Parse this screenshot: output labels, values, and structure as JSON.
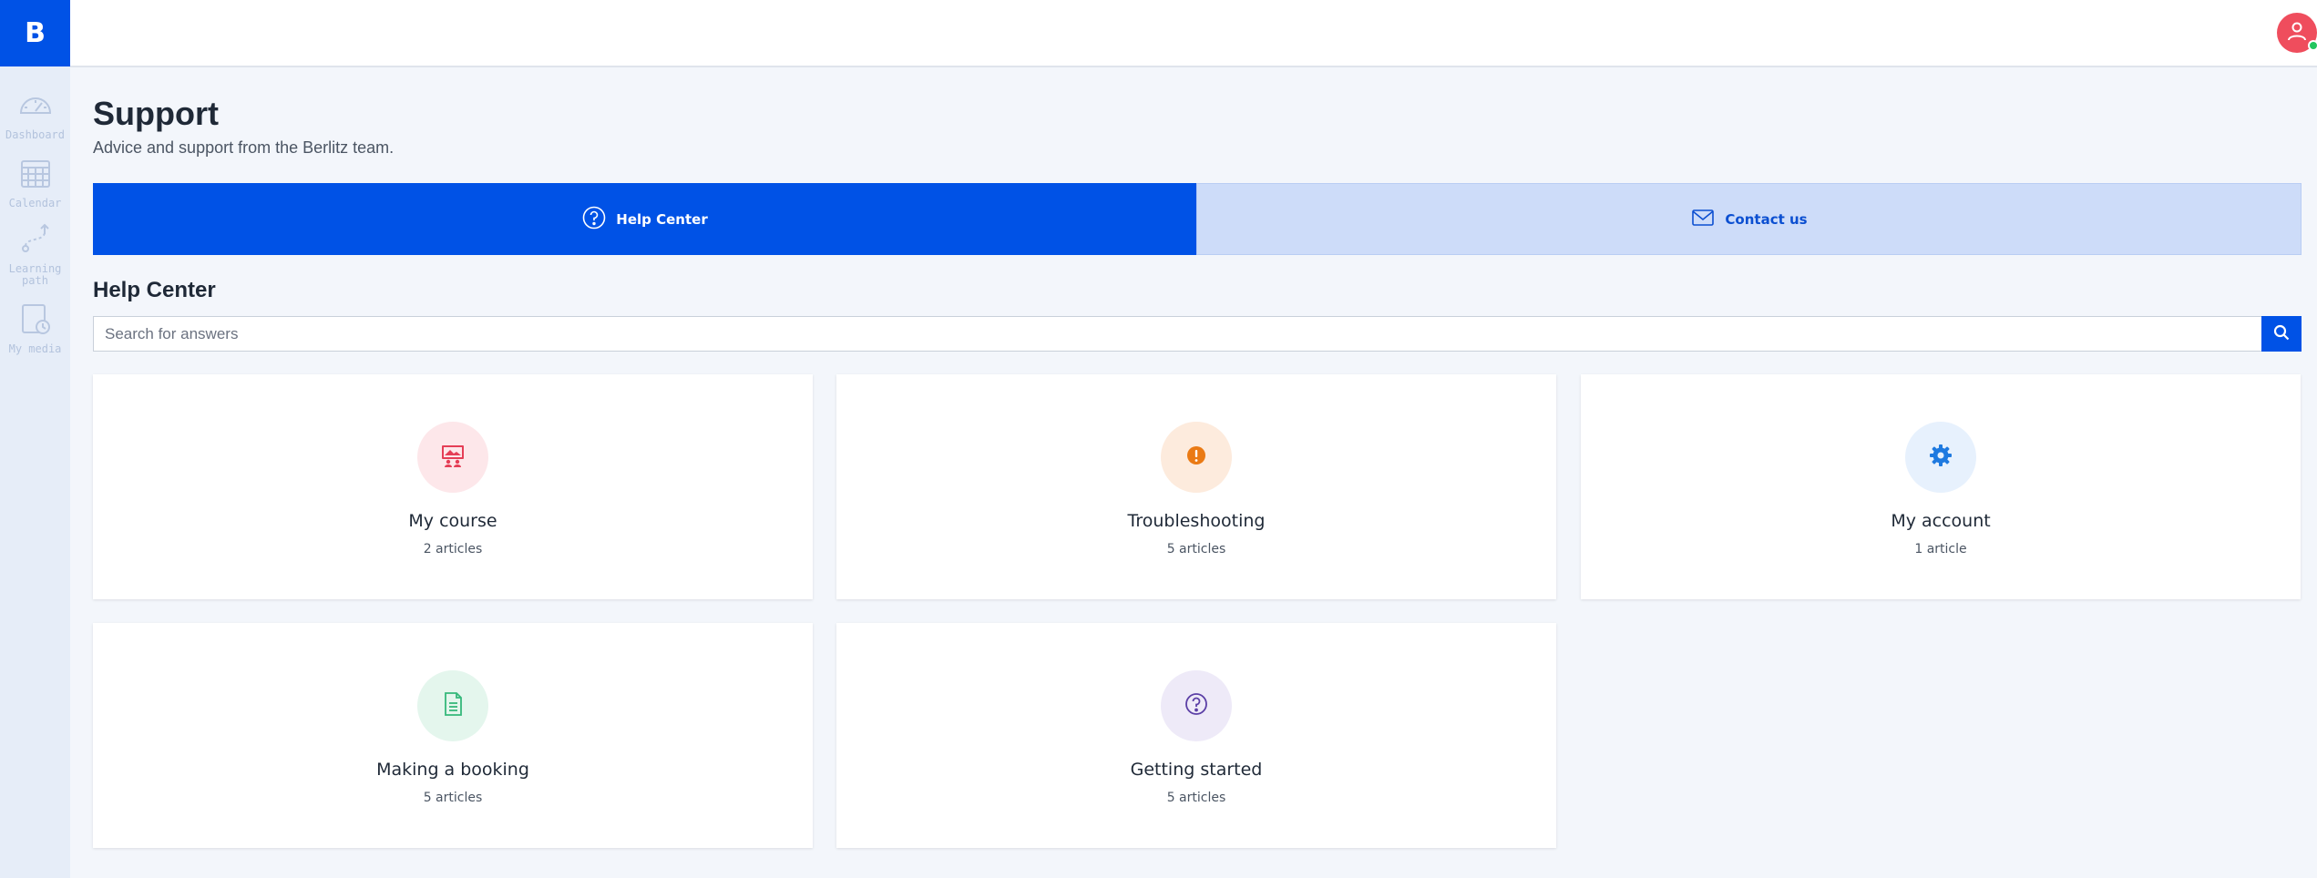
{
  "sidebar": {
    "logo": "B",
    "items": [
      {
        "label": "Dashboard",
        "icon": "dashboard-icon"
      },
      {
        "label": "Calendar",
        "icon": "calendar-icon"
      },
      {
        "label": "Learning path",
        "icon": "learning-path-icon"
      },
      {
        "label": "My media",
        "icon": "my-media-icon"
      }
    ]
  },
  "header": {
    "avatar_icon": "user-icon",
    "status": "online"
  },
  "page": {
    "title": "Support",
    "subtitle": "Advice and support from the Berlitz team."
  },
  "tabs": [
    {
      "label": "Help Center",
      "icon": "question-circle-icon",
      "active": true
    },
    {
      "label": "Contact us",
      "icon": "envelope-icon",
      "active": false
    }
  ],
  "help_center": {
    "title": "Help Center",
    "search_placeholder": "Search for answers",
    "search_value": ""
  },
  "categories": [
    {
      "title": "My course",
      "count": "2 articles",
      "icon": "presentation-icon",
      "color": "#e53e56",
      "bg": "#fde7ea"
    },
    {
      "title": "Troubleshooting",
      "count": "5 articles",
      "icon": "exclamation-icon",
      "color": "#ea7a14",
      "bg": "#fdebdd"
    },
    {
      "title": "My account",
      "count": "1 article",
      "icon": "gear-icon",
      "color": "#1f7ae0",
      "bg": "#e7f1fd"
    },
    {
      "title": "Making a booking",
      "count": "5 articles",
      "icon": "document-icon",
      "color": "#35b87a",
      "bg": "#e4f6ed"
    },
    {
      "title": "Getting started",
      "count": "5 articles",
      "icon": "question-icon",
      "color": "#5b3fa6",
      "bg": "#eeeaf8"
    }
  ],
  "colors": {
    "primary": "#0052e6",
    "tab_inactive": "#cddcf9",
    "background": "#f3f6fb"
  }
}
